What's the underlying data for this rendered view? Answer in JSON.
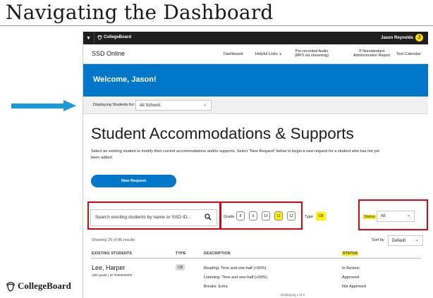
{
  "slide": {
    "title": "Navigating the Dashboard",
    "footer_logo": "CollegeBoard"
  },
  "topbar": {
    "menu_icon": "chevron-down-icon",
    "logo_text": "CollegeBoard",
    "user_name": "Jason Reynolds",
    "avatar_initial": "J"
  },
  "subnav": {
    "app_name": "SSD Online",
    "items": [
      "Dashboard",
      "Helpful Links ∨"
    ],
    "audio": [
      "Pre-recorded Audio",
      "(MP3 via streaming)"
    ],
    "report": [
      "® Nonstandard",
      "Administration Report"
    ],
    "calendar": "Test Calendar"
  },
  "hero": {
    "welcome": "Welcome, Jason!"
  },
  "filter": {
    "label": "Displaying Students for:",
    "selected": "All Schools"
  },
  "main": {
    "heading": "Student Accommodations & Supports",
    "description": "Select an existing student to modify their current accommodations and/or supports. Select “New Request” below to begin a new request for a student who has not yet been added.",
    "new_request": "New Request"
  },
  "search": {
    "placeholder": "Search existing students by name or SSD ID..."
  },
  "grade": {
    "label": "Grade",
    "options": [
      "8",
      "9",
      "10",
      "11",
      "12"
    ],
    "highlighted": "11"
  },
  "type_filter": {
    "label": "Type",
    "value": "CB"
  },
  "status_filter": {
    "label": "Status",
    "selected": "All"
  },
  "results": {
    "showing": "Showing 25 of 86 results",
    "sort_label": "Sort by",
    "sort_selected": "Default"
  },
  "table": {
    "headers": [
      "EXISTING STUDENTS",
      "TYPE",
      "DESCRIPTION",
      "STATUS"
    ],
    "rows": [
      {
        "name": "Lee, Harper",
        "meta": "12th grade  |  ID #000000000",
        "type": "CB",
        "descriptions": [
          "Reading: Time and one-half (+50%)",
          "Listening: Time and one-half (+50%)",
          "Breaks: Extra"
        ],
        "statuses": [
          "In Review",
          "Approved",
          "Not Approved"
        ]
      }
    ],
    "pager": "Displaying 1 of 3"
  },
  "colors": {
    "brand_blue": "#0077c8",
    "arrow_blue": "#1a9ad6",
    "highlight_yellow": "#fff200",
    "annotation_red": "#e0001a",
    "topbar_black": "#1e1e1e"
  }
}
